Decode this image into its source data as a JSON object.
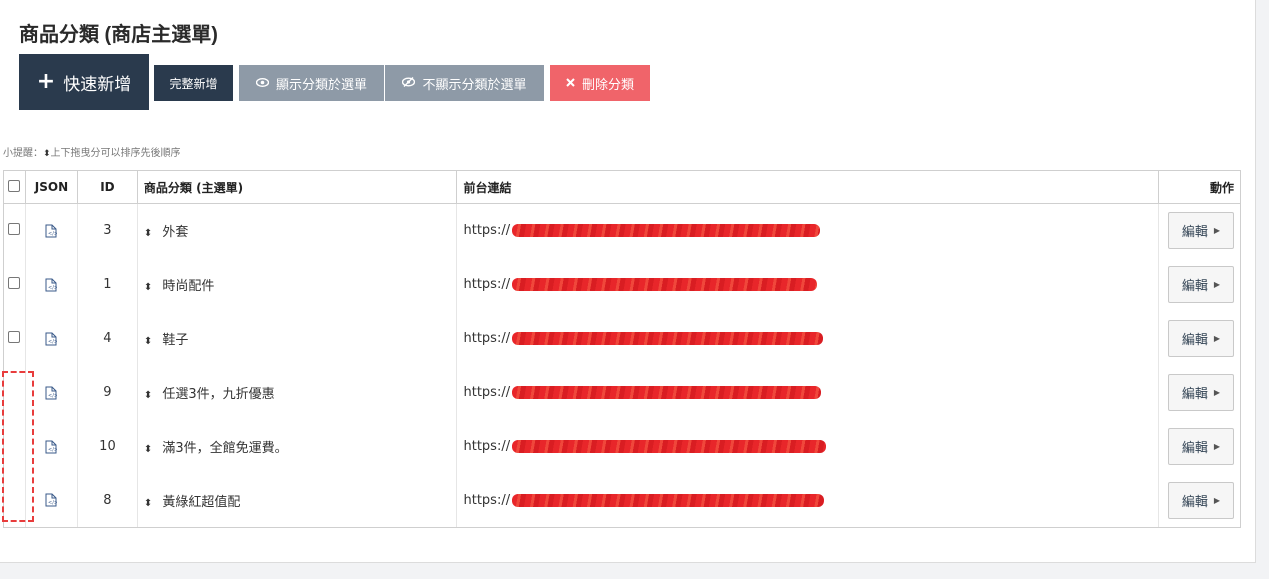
{
  "page": {
    "title": "商品分類 (商店主選單)"
  },
  "toolbar": {
    "quick_add_icon": "+",
    "quick_add_label": "快速新增",
    "full_add_label": "完整新增",
    "show_label": "顯示分類於選單",
    "show_icon": "eye-icon",
    "hide_label": "不顯示分類於選單",
    "hide_icon": "eye-slash-icon",
    "delete_label": "刪除分類",
    "delete_icon": "times-icon",
    "colors": {
      "dark": "#2a3a4d",
      "gray": "#8e9aa7",
      "danger": "#f0646a"
    }
  },
  "tip": {
    "prefix": "小提醒：",
    "text": "上下拖曳分可以排序先後順序"
  },
  "table": {
    "headers": {
      "json": "JSON",
      "id": "ID",
      "name": "商品分類 (主選單)",
      "link": "前台連結",
      "action": "動作"
    },
    "rows": [
      {
        "id": "3",
        "name": "外套",
        "link": "https://",
        "action": "編輯",
        "checkbox": true
      },
      {
        "id": "1",
        "name": "時尚配件",
        "link": "https://",
        "action": "編輯",
        "checkbox": true
      },
      {
        "id": "4",
        "name": "鞋子",
        "link": "https://",
        "action": "編輯",
        "checkbox": true
      },
      {
        "id": "9",
        "name": "任選3件，九折優惠",
        "link": "https://",
        "action": "編輯",
        "checkbox": false
      },
      {
        "id": "10",
        "name": "滿3件，全館免運費。",
        "link": "https://",
        "action": "編輯",
        "checkbox": false
      },
      {
        "id": "8",
        "name": "黃綠紅超值配",
        "link": "https://",
        "action": "編輯",
        "checkbox": false
      }
    ]
  }
}
